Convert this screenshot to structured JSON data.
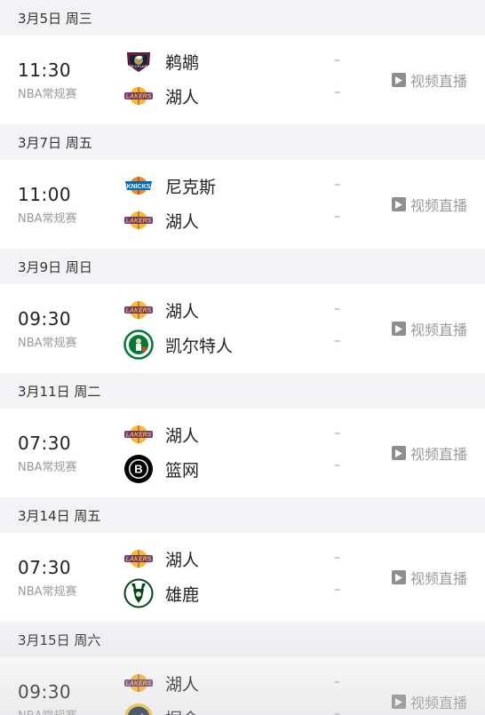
{
  "live_label": "视频直播",
  "groups": [
    {
      "date": "3月5日 周三",
      "match": {
        "time": "11:30",
        "league": "NBA常规赛",
        "home": {
          "name": "鹈鹕",
          "logo": "pelicans-logo",
          "score": "–"
        },
        "away": {
          "name": "湖人",
          "logo": "lakers-logo",
          "score": "–"
        }
      }
    },
    {
      "date": "3月7日 周五",
      "match": {
        "time": "11:00",
        "league": "NBA常规赛",
        "home": {
          "name": "尼克斯",
          "logo": "knicks-logo",
          "score": "–"
        },
        "away": {
          "name": "湖人",
          "logo": "lakers-logo",
          "score": "–"
        }
      }
    },
    {
      "date": "3月9日 周日",
      "match": {
        "time": "09:30",
        "league": "NBA常规赛",
        "home": {
          "name": "湖人",
          "logo": "lakers-logo",
          "score": "–"
        },
        "away": {
          "name": "凯尔特人",
          "logo": "celtics-logo",
          "score": "–"
        }
      }
    },
    {
      "date": "3月11日 周二",
      "match": {
        "time": "07:30",
        "league": "NBA常规赛",
        "home": {
          "name": "湖人",
          "logo": "lakers-logo",
          "score": "–"
        },
        "away": {
          "name": "篮网",
          "logo": "nets-logo",
          "score": "–"
        }
      }
    },
    {
      "date": "3月14日 周五",
      "match": {
        "time": "07:30",
        "league": "NBA常规赛",
        "home": {
          "name": "湖人",
          "logo": "lakers-logo",
          "score": "–"
        },
        "away": {
          "name": "雄鹿",
          "logo": "bucks-logo",
          "score": "–"
        }
      }
    },
    {
      "date": "3月15日 周六",
      "match": {
        "time": "09:30",
        "league": "NBA常规赛",
        "home": {
          "name": "湖人",
          "logo": "lakers-logo",
          "score": "–"
        },
        "away": {
          "name": "掘金",
          "logo": "nuggets-logo",
          "score": "–"
        }
      }
    }
  ],
  "colors": {
    "lakers_purple": "#552583",
    "lakers_gold": "#FDB927",
    "knicks_blue": "#006BB6",
    "knicks_orange": "#F58426",
    "pelicans_navy": "#0C2340",
    "pelicans_red": "#C8102E",
    "celtics_green": "#007A33",
    "bucks_green": "#00471B",
    "nuggets_navy": "#0E2240",
    "nuggets_gold": "#FEC524"
  }
}
